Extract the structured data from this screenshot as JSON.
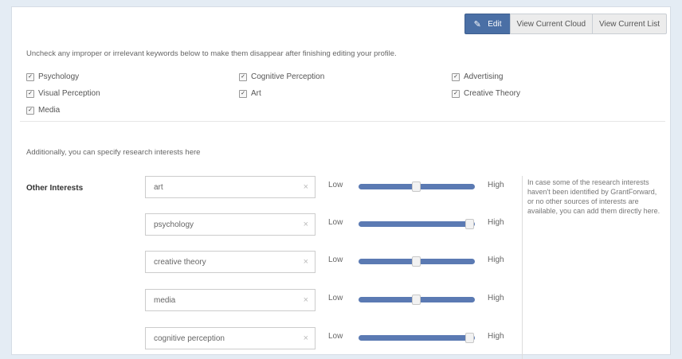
{
  "toolbar": {
    "edit_label": "Edit",
    "view_cloud_label": "View Current Cloud",
    "view_list_label": "View Current List"
  },
  "intro_text": "Uncheck any improper or irrelevant keywords below to make them disappear after finishing editing your profile.",
  "keywords": [
    {
      "label": "Psychology",
      "checked": true
    },
    {
      "label": "Cognitive Perception",
      "checked": true
    },
    {
      "label": "Advertising",
      "checked": true
    },
    {
      "label": "Visual Perception",
      "checked": true
    },
    {
      "label": "Art",
      "checked": true
    },
    {
      "label": "Creative Theory",
      "checked": true
    },
    {
      "label": "Media",
      "checked": true
    }
  ],
  "additional_text": "Additionally, you can specify research interests here",
  "other_interests_label": "Other Interests",
  "slider_low_label": "Low",
  "slider_high_label": "High",
  "interests": [
    {
      "value": "art",
      "level": 0.5
    },
    {
      "value": "psychology",
      "level": 1.0
    },
    {
      "value": "creative theory",
      "level": 0.5
    },
    {
      "value": "media",
      "level": 0.5
    },
    {
      "value": "cognitive perception",
      "level": 1.0
    }
  ],
  "help_text": "In case some of the research interests haven't been identified by GrantForward, or no other sources of interests are available, you can add them directly here.",
  "colors": {
    "accent": "#4a6fa5",
    "slider": "#5b7ab3"
  }
}
